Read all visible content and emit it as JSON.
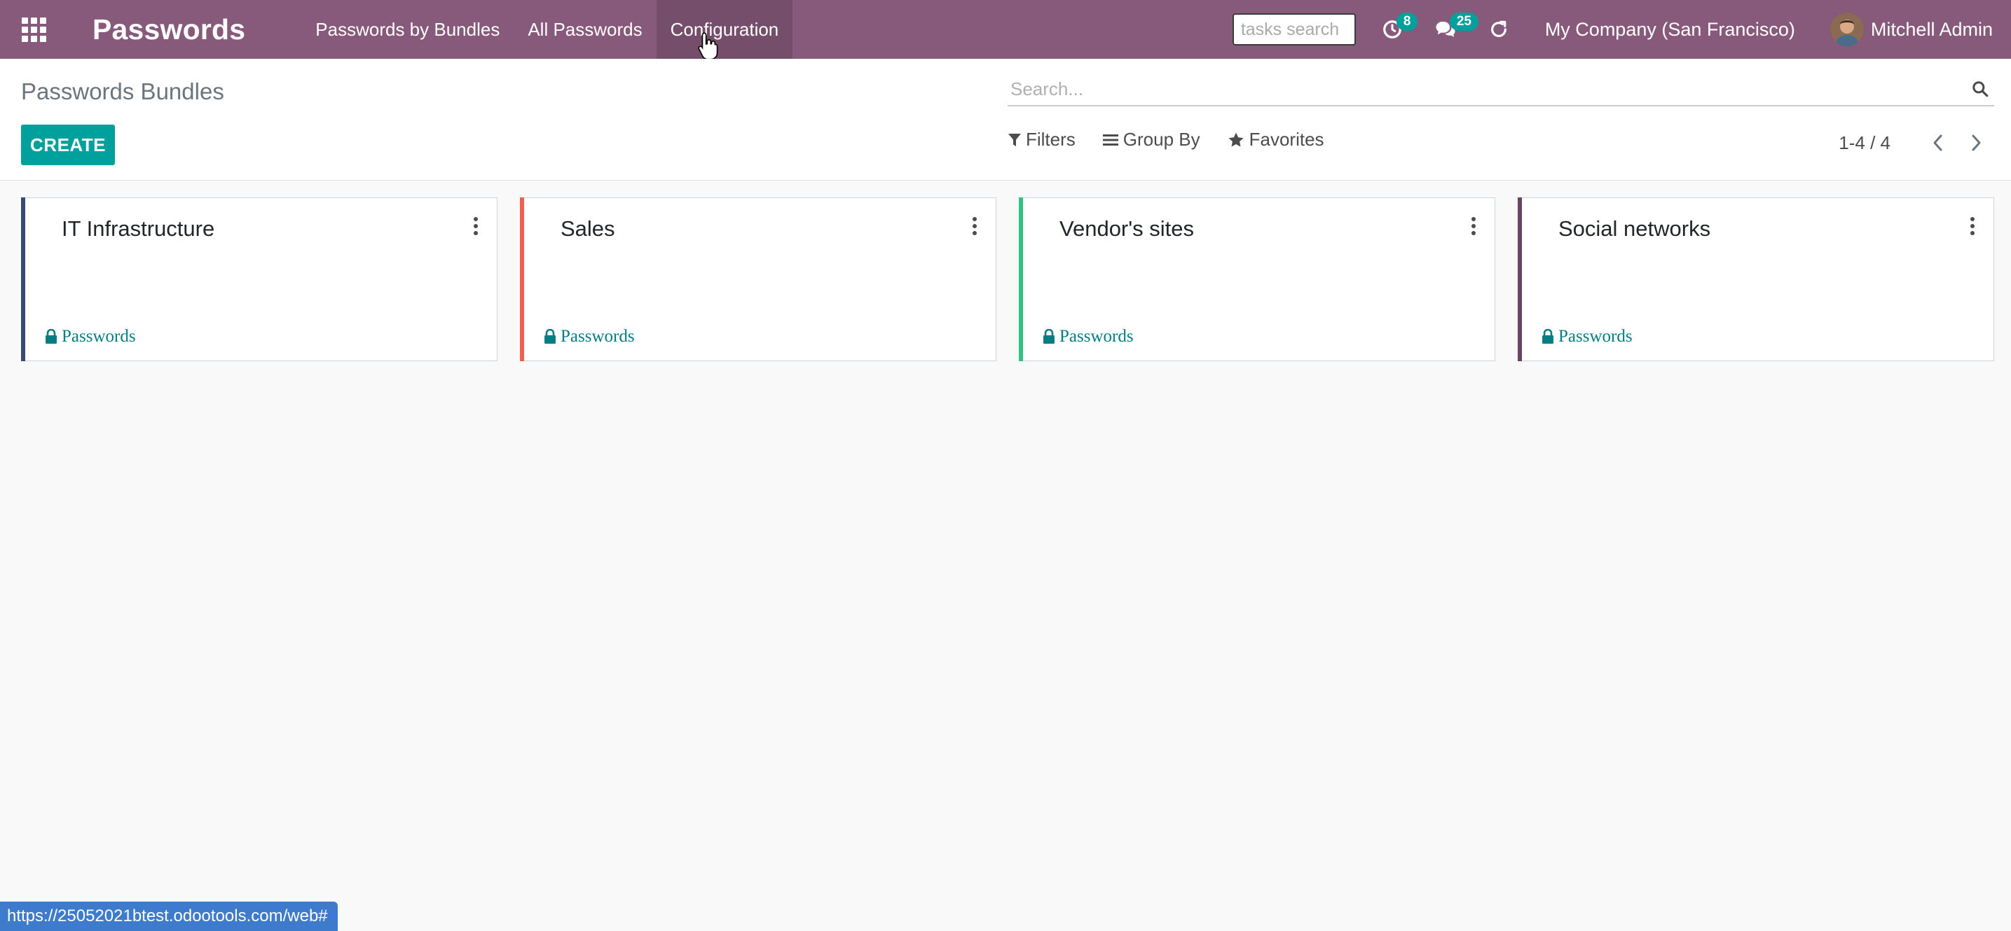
{
  "navbar": {
    "app_title": "Passwords",
    "menu": [
      {
        "label": "Passwords by Bundles"
      },
      {
        "label": "All Passwords"
      },
      {
        "label": "Configuration"
      }
    ],
    "tasks_search_placeholder": "tasks search",
    "activity_count": "8",
    "messages_count": "25",
    "company": "My Company (San Francisco)",
    "user_name": "Mitchell Admin",
    "icons": [
      "apps-grid-icon",
      "activity-clock-icon",
      "chat-bubbles-icon",
      "refresh-icon"
    ]
  },
  "control_panel": {
    "breadcrumb": "Passwords Bundles",
    "create_label": "CREATE",
    "search_placeholder": "Search...",
    "filters_label": "Filters",
    "group_by_label": "Group By",
    "favorites_label": "Favorites",
    "pager_value": "1-4 / 4"
  },
  "kanban": {
    "cards": [
      {
        "title": "IT Infrastructure",
        "link_label": "Passwords",
        "color": "#374c73"
      },
      {
        "title": "Sales",
        "link_label": "Passwords",
        "color": "#f06050"
      },
      {
        "title": "Vendor's sites",
        "link_label": "Passwords",
        "color": "#30c381"
      },
      {
        "title": "Social networks",
        "link_label": "Passwords",
        "color": "#6c4164"
      }
    ]
  },
  "status_bar": {
    "url": "https://25052021btest.odootools.com/web#"
  },
  "colors": {
    "navbar": "#875a7b",
    "primary": "#00a09d",
    "link": "#017e84"
  }
}
